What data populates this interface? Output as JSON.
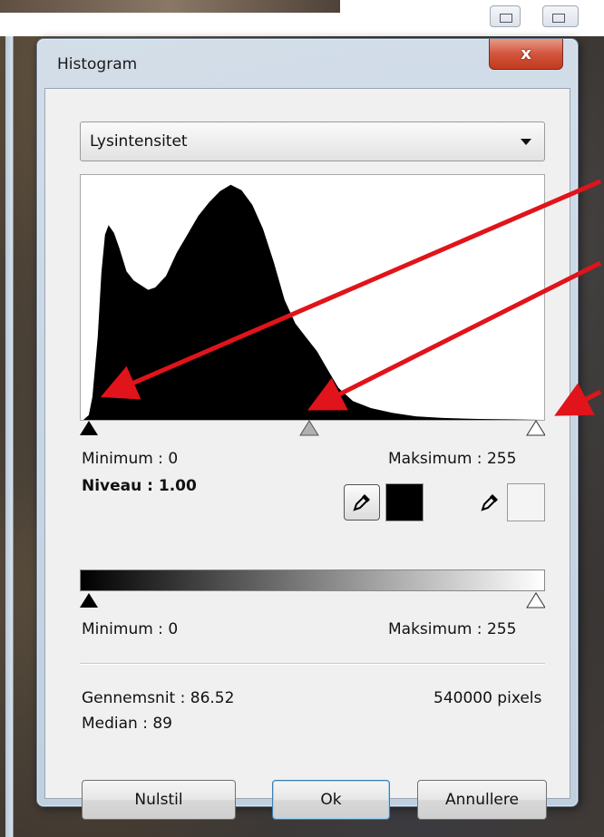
{
  "window": {
    "title": "Histogram",
    "close_label": "x"
  },
  "channel_select": {
    "value": "Lysintensitet"
  },
  "input_levels": {
    "minimum_text": "Minimum : 0",
    "maximum_text": "Maksimum : 255",
    "level_text": "Niveau : 1.00",
    "black_point": 0,
    "gamma_point": 128,
    "white_point": 255
  },
  "output_levels": {
    "minimum_text": "Minimum : 0",
    "maximum_text": "Maksimum : 255"
  },
  "stats": {
    "mean_text": "Gennemsnit : 86.52",
    "median_text": "Median : 89",
    "pixels_text": "540000 pixels"
  },
  "buttons": {
    "reset": "Nulstil",
    "ok": "Ok",
    "cancel": "Annullere"
  },
  "colors": {
    "annotation_arrow": "#e0141a",
    "histogram_fill": "#000000",
    "gamma_slider": "#b0b0b0"
  },
  "chart_data": {
    "type": "area",
    "x_range": [
      0,
      255
    ],
    "histogram_profile": [
      [
        0,
        0
      ],
      [
        3,
        0.02
      ],
      [
        5,
        0.1
      ],
      [
        8,
        0.35
      ],
      [
        10,
        0.62
      ],
      [
        12,
        0.78
      ],
      [
        14,
        0.82
      ],
      [
        17,
        0.8
      ],
      [
        20,
        0.72
      ],
      [
        24,
        0.62
      ],
      [
        28,
        0.58
      ],
      [
        32,
        0.56
      ],
      [
        36,
        0.54
      ],
      [
        40,
        0.55
      ],
      [
        46,
        0.6
      ],
      [
        52,
        0.7
      ],
      [
        58,
        0.78
      ],
      [
        64,
        0.86
      ],
      [
        70,
        0.92
      ],
      [
        76,
        0.97
      ],
      [
        82,
        1.0
      ],
      [
        88,
        0.98
      ],
      [
        94,
        0.92
      ],
      [
        100,
        0.82
      ],
      [
        106,
        0.68
      ],
      [
        112,
        0.52
      ],
      [
        118,
        0.42
      ],
      [
        124,
        0.36
      ],
      [
        130,
        0.3
      ],
      [
        136,
        0.22
      ],
      [
        142,
        0.14
      ],
      [
        150,
        0.08
      ],
      [
        160,
        0.05
      ],
      [
        172,
        0.03
      ],
      [
        185,
        0.015
      ],
      [
        200,
        0.008
      ],
      [
        220,
        0.004
      ],
      [
        240,
        0.002
      ],
      [
        255,
        0
      ]
    ]
  }
}
